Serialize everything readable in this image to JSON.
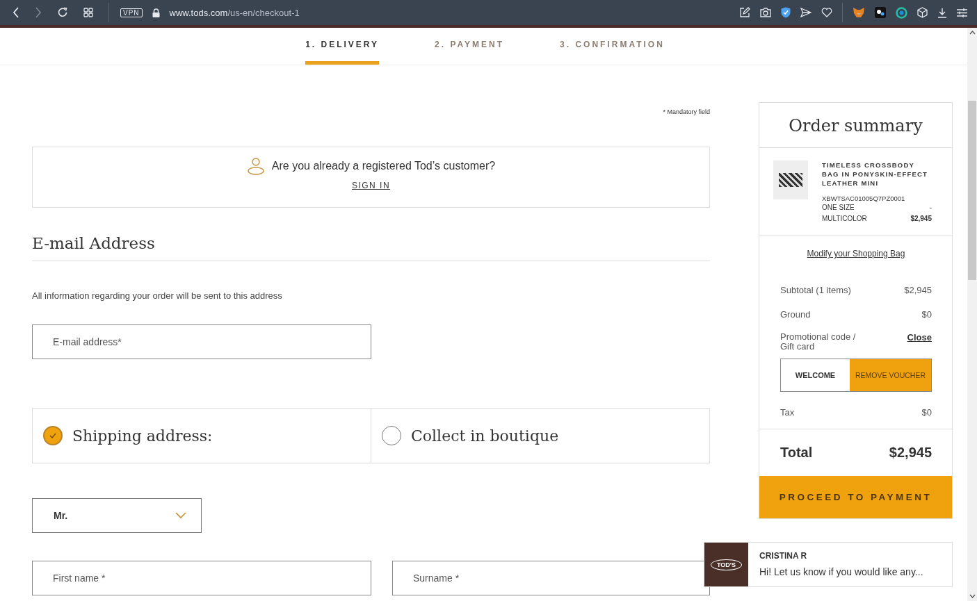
{
  "browser": {
    "vpn_label": "VPN",
    "url_host": "www.tods.com",
    "url_path": "/us-en/checkout-1"
  },
  "steps": [
    {
      "label": "1. DELIVERY",
      "selected": true
    },
    {
      "label": "2. PAYMENT",
      "selected": false
    },
    {
      "label": "3. CONFIRMATION",
      "selected": false
    }
  ],
  "mandatory_note": "* Mandatory field",
  "login_prompt": {
    "question": "Are you already a registered Tod’s customer?",
    "link": "SIGN IN"
  },
  "email_section": {
    "title": "E-mail Address",
    "note": "All information regarding your order will be sent to this address",
    "field": {
      "placeholder": "E-mail address*"
    }
  },
  "delivery_options": [
    {
      "label": "Shipping address:",
      "selected": true
    },
    {
      "label": "Collect in boutique",
      "selected": false
    }
  ],
  "title_select": {
    "value": "Mr."
  },
  "name_fields": [
    {
      "placeholder": "First name *"
    },
    {
      "placeholder": "Surname *"
    }
  ],
  "order_summary": {
    "title": "Order summary",
    "item": {
      "name": "TIMELESS CROSSBODY BAG IN PONYSKIN-EFFECT LEATHER MINI",
      "sku": "XBWTSAC01005Q7PZ0001",
      "size": "ONE SIZE",
      "size_note": "-",
      "color_label": "MULTICOLOR",
      "price": "$2,945"
    },
    "modify_link": "Modify your Shopping Bag",
    "subtotal": {
      "label": "Subtotal (1 items)",
      "value": "$2,945"
    },
    "shipping": {
      "label": "Ground",
      "value": "$0"
    },
    "promo": {
      "label": "Promotional code / Gift card",
      "close": "Close",
      "code": "WELCOME",
      "remove": "REMOVE VOUCHER"
    },
    "tax": {
      "label": "Tax",
      "value": "$0"
    },
    "total": {
      "label": "Total",
      "value": "$2,945"
    },
    "button": "PROCEED TO PAYMENT"
  },
  "chat": {
    "logo": "TOD'S",
    "agent": "CRISTINA R",
    "message": "Hi! Let us know if you would like any..."
  }
}
